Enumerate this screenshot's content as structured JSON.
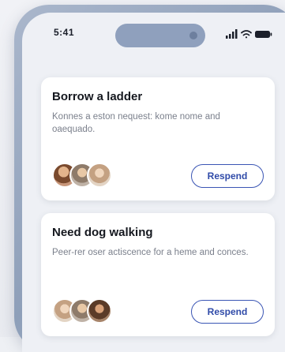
{
  "status_bar": {
    "time": "5:41",
    "icons": [
      "signal-icon",
      "wifi-icon",
      "battery-icon"
    ]
  },
  "requests": [
    {
      "title": "Borrow a ladder",
      "description": "Konnes a eston nequest: kome nome and oaequado.",
      "respond_label": "Respend"
    },
    {
      "title": "Need dog walking",
      "description": "Peer-rer oser actiscence for a heme and conces.",
      "respond_label": "Respend"
    }
  ],
  "colors": {
    "accent": "#2f4aa8",
    "frame": "#9aaac3",
    "card": "#ffffff"
  }
}
